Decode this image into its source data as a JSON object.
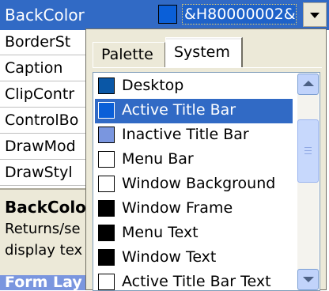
{
  "property_grid": {
    "selected_property": "BackColor",
    "selected_value": "&H80000002&",
    "selected_swatch_color": "#0a5fd8",
    "rows": [
      {
        "label": "BorderSt"
      },
      {
        "label": "Caption"
      },
      {
        "label": "ClipContr"
      },
      {
        "label": "ControlBo"
      },
      {
        "label": "DrawMod"
      },
      {
        "label": "DrawStyl"
      }
    ]
  },
  "description": {
    "title": "BackColo",
    "line1": "Returns/se",
    "line2": "display tex"
  },
  "form_layout": {
    "title": "Form Lay"
  },
  "color_popup": {
    "tabs": [
      {
        "label": "Palette"
      },
      {
        "label": "System"
      }
    ],
    "active_tab": "System",
    "items": [
      {
        "label": "Desktop",
        "color": "#0a57a6"
      },
      {
        "label": "Active Title Bar",
        "color": "#0a5fd8"
      },
      {
        "label": "Inactive Title Bar",
        "color": "#7a96df"
      },
      {
        "label": "Menu Bar",
        "color": "#ffffff"
      },
      {
        "label": "Window Background",
        "color": "#ffffff"
      },
      {
        "label": "Window Frame",
        "color": "#000000"
      },
      {
        "label": "Menu Text",
        "color": "#000000"
      },
      {
        "label": "Window Text",
        "color": "#000000"
      },
      {
        "label": "Active Title Bar Text",
        "color": "#ffffff"
      }
    ],
    "selected_item": "Active Title Bar"
  },
  "colors": {
    "selection": "#316ac5",
    "panel": "#ece9d8"
  }
}
